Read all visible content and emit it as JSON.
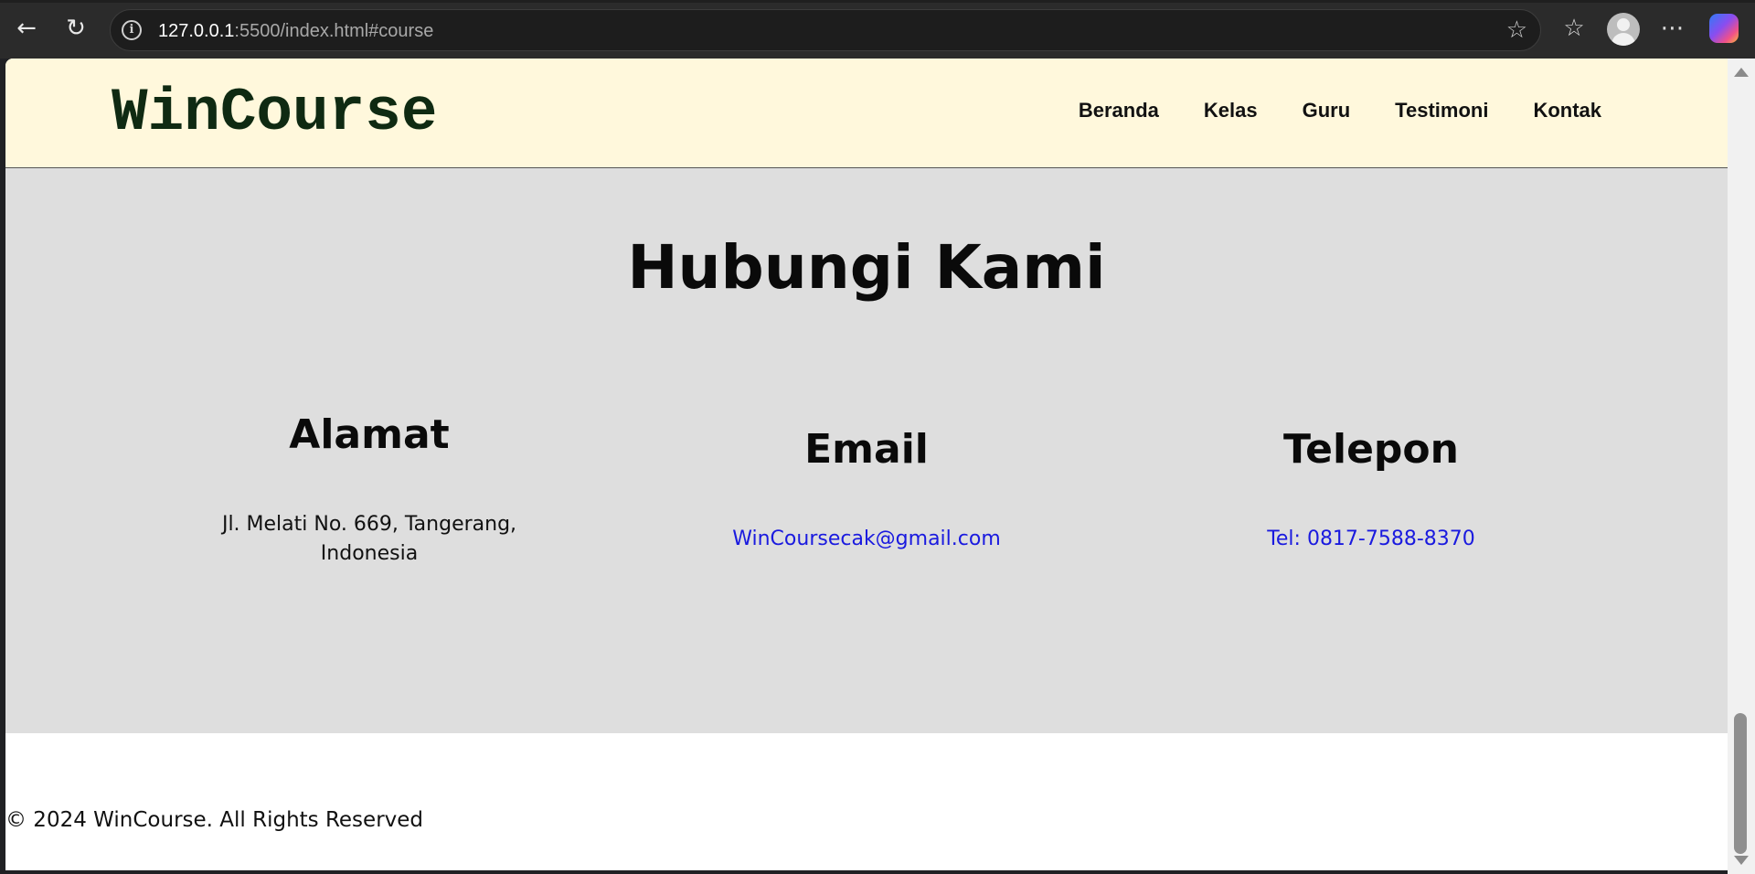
{
  "browser": {
    "url_host": "127.0.0.1",
    "url_rest": ":5500/index.html#course",
    "icons": [
      "back-arrow-icon",
      "reload-icon",
      "info-icon",
      "star-icon",
      "favorites-icon",
      "profile-icon",
      "more-icon",
      "copilot-icon"
    ]
  },
  "header": {
    "logo": "WinCourse",
    "nav": [
      "Beranda",
      "Kelas",
      "Guru",
      "Testimoni",
      "Kontak"
    ]
  },
  "contact": {
    "title": "Hubungi Kami",
    "address": {
      "title": "Alamat",
      "text": "Jl. Melati No. 669, Tangerang, Indonesia"
    },
    "email": {
      "title": "Email",
      "link": "WinCoursecak@gmail.com"
    },
    "phone": {
      "title": "Telepon",
      "link": "Tel: 0817-7588-8370"
    }
  },
  "footer": {
    "text": "© 2024 WinCourse. All Rights Reserved"
  },
  "colors": {
    "header_bg": "#fff8dc",
    "logo": "#0f2a12",
    "section_bg": "#dedede",
    "link": "#1a1adf"
  }
}
